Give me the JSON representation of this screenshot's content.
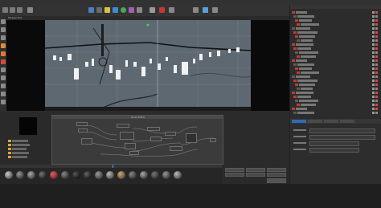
{
  "app": {
    "title": "",
    "menu_items": [
      "",
      "",
      "",
      "",
      "",
      "",
      "",
      "",
      "",
      "",
      ""
    ]
  },
  "viewport": {
    "label": "Perspective",
    "status": "",
    "overlay_text": ""
  },
  "node_editor": {
    "title": "Node Editor"
  },
  "object_manager": {
    "rows": 26
  },
  "attribute_manager": {
    "tabs": [
      "",
      "",
      "",
      ""
    ],
    "fields": [
      "",
      "",
      "",
      ""
    ]
  },
  "material_browser": {
    "count": 16
  },
  "colors": {
    "accent_red": "#c23a2c",
    "accent_blue": "#2f6bb5",
    "panel_bg": "#2b2b2b",
    "viewport_bg": "#5a6670"
  },
  "icons": [
    "move-icon",
    "scale-icon",
    "rotate-icon",
    "undo-icon",
    "render-icon",
    "camera-icon",
    "light-icon",
    "cube-icon",
    "sphere-icon",
    "spline-icon"
  ]
}
